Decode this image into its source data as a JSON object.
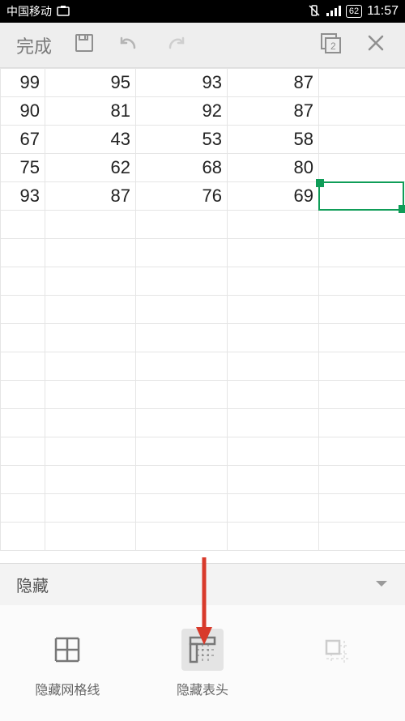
{
  "status_bar": {
    "carrier": "中国移动",
    "battery": "62",
    "time": "11:57"
  },
  "toolbar": {
    "done_label": "完成",
    "window_badge": "2"
  },
  "sheet": {
    "rows": [
      [
        "99",
        "95",
        "93",
        "87"
      ],
      [
        "90",
        "81",
        "92",
        "87"
      ],
      [
        "67",
        "43",
        "53",
        "58"
      ],
      [
        "75",
        "62",
        "68",
        "80"
      ],
      [
        "93",
        "87",
        "76",
        "69"
      ]
    ]
  },
  "panel": {
    "title": "隐藏"
  },
  "tools": {
    "grid_label": "隐藏网格线",
    "header_label": "隐藏表头"
  }
}
